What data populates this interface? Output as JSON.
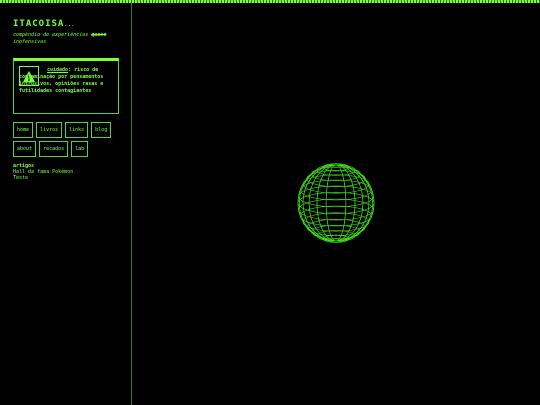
{
  "site": {
    "title": "ITACOISA",
    "title_dots": "...",
    "tagline_before": "compêndio de experiências ",
    "tagline_strike": "quase",
    "tagline_after": " inofensivas"
  },
  "warning": {
    "icon": "warning-triangle-icon",
    "caution_word": "cuidado",
    "message": ": risco de contaminação por pensamentos intrusivos, opiniões rasas e futilidades contagiantes"
  },
  "nav": {
    "row1": [
      "home",
      "livros",
      "links",
      "blog"
    ],
    "row2": [
      "about",
      "recados",
      "lab"
    ]
  },
  "articles": {
    "title": "artigos",
    "items": [
      "Hall da fama Pokémon",
      "Teste"
    ]
  },
  "colors": {
    "accent": "#7dff3a",
    "background": "#000000",
    "border": "#5bd32a"
  }
}
